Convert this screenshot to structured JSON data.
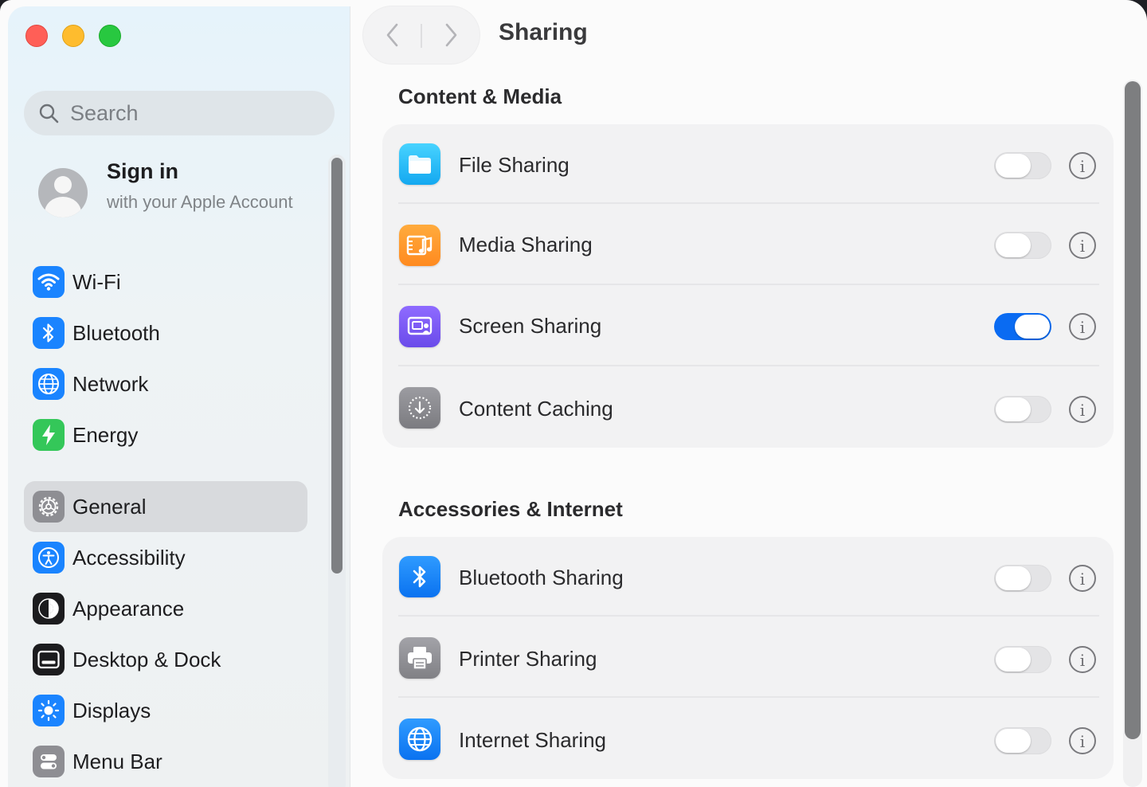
{
  "sidebar": {
    "search_placeholder": "Search",
    "signin": {
      "title": "Sign in",
      "subtitle": "with your Apple Account"
    },
    "items": [
      {
        "label": "Wi-Fi",
        "icon": "wifi-icon",
        "color": "#1a84ff"
      },
      {
        "label": "Bluetooth",
        "icon": "bluetooth-icon",
        "color": "#1a84ff"
      },
      {
        "label": "Network",
        "icon": "globe-icon",
        "color": "#1a84ff"
      },
      {
        "label": "Energy",
        "icon": "lightning-icon",
        "color": "#34c759"
      },
      {
        "label": "General",
        "icon": "gear-icon",
        "color": "#8e8e93",
        "selected": true
      },
      {
        "label": "Accessibility",
        "icon": "accessibility-icon",
        "color": "#1a84ff"
      },
      {
        "label": "Appearance",
        "icon": "appearance-icon",
        "color": "#1c1c1e"
      },
      {
        "label": "Desktop & Dock",
        "icon": "dock-icon",
        "color": "#1c1c1e"
      },
      {
        "label": "Displays",
        "icon": "sun-icon",
        "color": "#1a84ff"
      },
      {
        "label": "Menu Bar",
        "icon": "menubar-icon",
        "color": "#8e8e93"
      }
    ]
  },
  "main": {
    "title": "Sharing",
    "sections": [
      {
        "title": "Content & Media",
        "rows": [
          {
            "label": "File Sharing",
            "icon": "folder-icon",
            "enabled": false
          },
          {
            "label": "Media Sharing",
            "icon": "media-icon",
            "enabled": false
          },
          {
            "label": "Screen Sharing",
            "icon": "screen-sharing-icon",
            "enabled": true
          },
          {
            "label": "Content Caching",
            "icon": "content-caching-icon",
            "enabled": false
          }
        ]
      },
      {
        "title": "Accessories & Internet",
        "rows": [
          {
            "label": "Bluetooth Sharing",
            "icon": "bluetooth-icon",
            "enabled": false
          },
          {
            "label": "Printer Sharing",
            "icon": "printer-icon",
            "enabled": false
          },
          {
            "label": "Internet Sharing",
            "icon": "globe-icon",
            "enabled": false
          }
        ]
      }
    ],
    "info_glyph": "i"
  },
  "colors": {
    "accent": "#0a6bf2",
    "close": "#ff5f57",
    "minimize": "#febc2e",
    "zoom": "#28c840"
  }
}
